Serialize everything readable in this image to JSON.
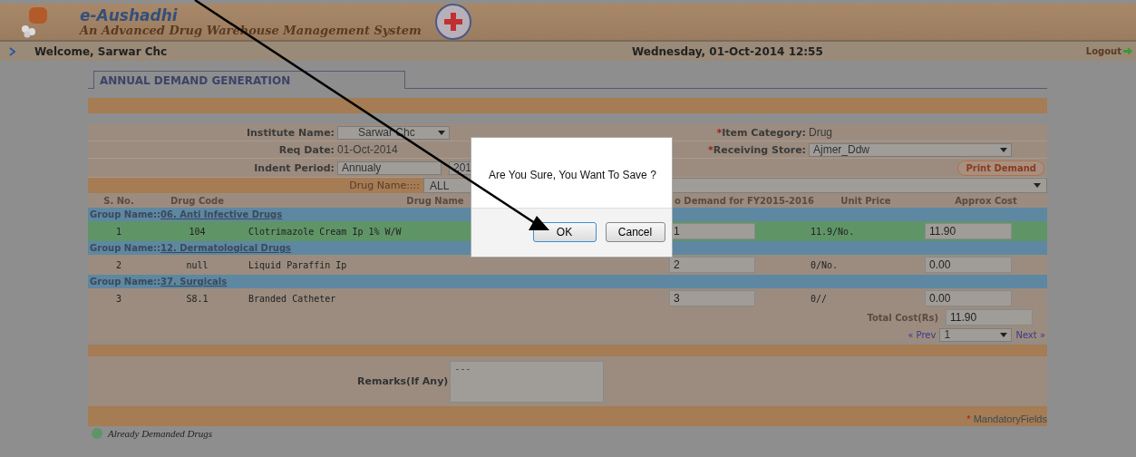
{
  "header": {
    "app_name": "e-Aushadhi",
    "tagline": "An Advanced Drug Warehouse Management System"
  },
  "welcome": "Welcome, Sarwar Chc",
  "datetime": "Wednesday, 01-Oct-2014 12:55",
  "logout": "Logout",
  "tab": {
    "label": "ANNUAL DEMAND GENERATION",
    "selected": true
  },
  "form": {
    "institute": {
      "label": "Institute Name:",
      "value": "Sarwar Chc"
    },
    "item_category": {
      "mark": "*",
      "label": "Item Category:",
      "value": "Drug"
    },
    "req_date": {
      "label": "Req Date:",
      "value": "01-Oct-2014"
    },
    "receiving_store": {
      "mark": "*",
      "label": "Receiving Store:",
      "value": "Ajmer_Ddw"
    },
    "indent_period": {
      "label": "Indent Period:",
      "value": "Annualy",
      "year": "201"
    },
    "print_button": "Print Demand",
    "drug_name": {
      "label": "Drug Name::::",
      "value": "ALL"
    }
  },
  "table": {
    "columns": [
      "S. No.",
      "Drug Code",
      "Drug Name",
      "o Demand for FY2015-2016",
      "Unit Price",
      "Approx Cost"
    ],
    "groups": [
      {
        "prefix": "Group Name::",
        "name": "06. Anti Infective Drugs",
        "rows": [
          {
            "sno": "1",
            "code": "104",
            "name": "Clotrimazole Cream Ip 1% W/W",
            "qty": "1",
            "unit_price": "11.9/No.",
            "cost": "11.90",
            "already_demanded": true
          }
        ]
      },
      {
        "prefix": "Group Name::",
        "name": "12. Dermatological Drugs",
        "rows": [
          {
            "sno": "2",
            "code": "null",
            "name": "Liquid Paraffin Ip",
            "qty": "2",
            "unit_price": "0/No.",
            "cost": "0.00",
            "already_demanded": false
          }
        ]
      },
      {
        "prefix": "Group Name::",
        "name": "37. Surgicals",
        "rows": [
          {
            "sno": "3",
            "code": "S8.1",
            "name": "Branded Catheter",
            "qty": "3",
            "unit_price": "0//",
            "cost": "0.00",
            "already_demanded": false
          }
        ]
      }
    ]
  },
  "total": {
    "label": "Total Cost(Rs)",
    "value": "11.90"
  },
  "pagination": {
    "prev": "« Prev",
    "page": "1",
    "next": "Next »"
  },
  "remarks": {
    "label": "Remarks(If Any)",
    "value": "---"
  },
  "mandatory": {
    "mark": "*",
    "label": "MandatoryFields"
  },
  "legend": "Already Demanded Drugs",
  "dialog": {
    "message": "Are You Sure, You Want To Save ?",
    "buttons": [
      {
        "label": "OK",
        "focused": true
      },
      {
        "label": "Cancel",
        "focused": false
      }
    ]
  }
}
